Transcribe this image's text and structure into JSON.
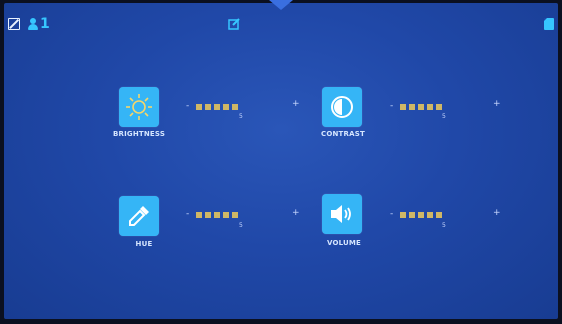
{
  "header": {
    "user_number": "1"
  },
  "settings": [
    {
      "label": "BRIGHTNESS",
      "value": "5",
      "minus": "-",
      "plus": "+",
      "icon": "sun-icon"
    },
    {
      "label": "CONTRAST",
      "value": "5",
      "minus": "-",
      "plus": "+",
      "icon": "contrast-icon"
    },
    {
      "label": "HUE",
      "value": "5",
      "minus": "-",
      "plus": "+",
      "icon": "eyedropper-icon"
    },
    {
      "label": "VOLUME",
      "value": "5",
      "minus": "-",
      "plus": "+",
      "icon": "speaker-icon"
    }
  ],
  "colors": {
    "background": "#2048a8",
    "tile": "#35b5f6",
    "segment": "#cfb766",
    "accent": "#36c6ff"
  }
}
